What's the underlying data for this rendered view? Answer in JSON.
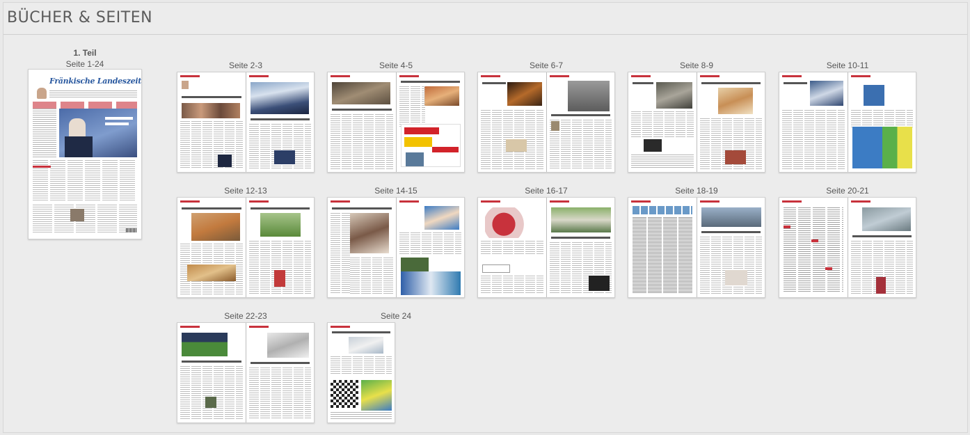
{
  "header": {
    "title": "BÜCHER & SEITEN"
  },
  "book": {
    "title": "1. Teil",
    "range": "Seite 1-24"
  },
  "cover": {
    "label": "Seite 1-24",
    "masthead": "Fränkische Landeszeitung"
  },
  "spreads": [
    {
      "label": "Seite 2-3"
    },
    {
      "label": "Seite 4-5"
    },
    {
      "label": "Seite 6-7"
    },
    {
      "label": "Seite 8-9"
    },
    {
      "label": "Seite 10-11"
    },
    {
      "label": "Seite 12-13"
    },
    {
      "label": "Seite 14-15"
    },
    {
      "label": "Seite 16-17"
    },
    {
      "label": "Seite 18-19"
    },
    {
      "label": "Seite 20-21"
    },
    {
      "label": "Seite 22-23"
    },
    {
      "label": "Seite 24"
    }
  ],
  "colors": {
    "accent": "#c8323c",
    "masthead": "#2b5aa0",
    "background": "#ececec"
  }
}
